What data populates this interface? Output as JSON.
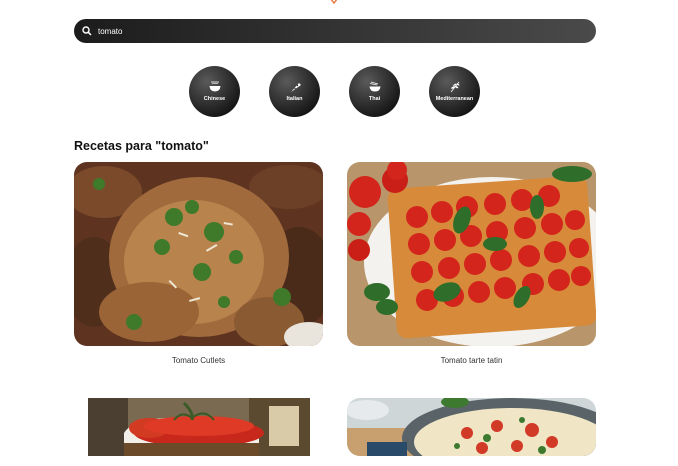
{
  "search": {
    "value": "tomato",
    "placeholder": ""
  },
  "categories": [
    {
      "label": "Chinese",
      "icon": "bowl-icon"
    },
    {
      "label": "Italian",
      "icon": "pizza-slice-icon"
    },
    {
      "label": "Thai",
      "icon": "noodle-bowl-icon"
    },
    {
      "label": "Mediterranean",
      "icon": "olive-branch-icon"
    }
  ],
  "results": {
    "title": "Recetas para \"tomato\"",
    "recipes": [
      {
        "title": "Tomato Cutlets"
      },
      {
        "title": "Tomato tarte tatin"
      },
      {
        "title": ""
      },
      {
        "title": ""
      }
    ]
  },
  "colors": {
    "accent": "#e8743b",
    "search_bg": "#2b2b2b",
    "category_bg": "#1e1e1e"
  }
}
